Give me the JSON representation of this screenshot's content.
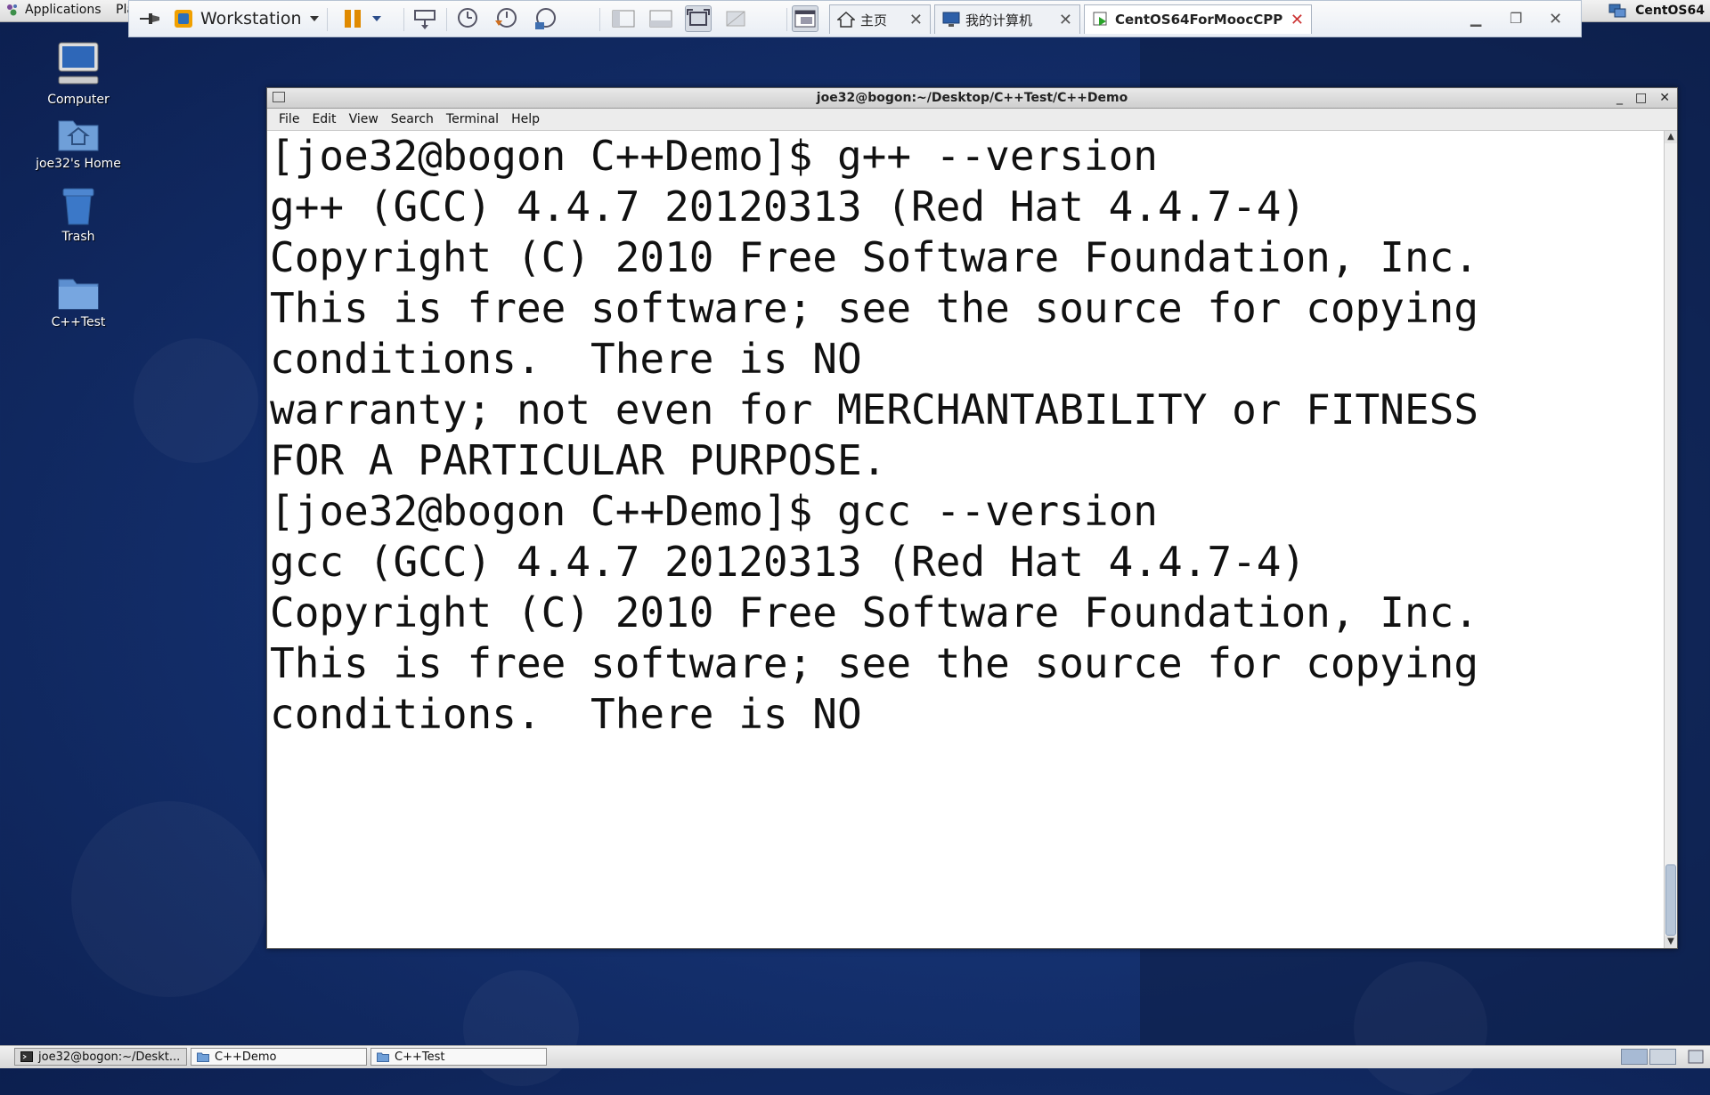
{
  "gnome_panel": {
    "applications_label": "Applications",
    "places_label": "Pla",
    "host_label": "CentOS64"
  },
  "vmware": {
    "workstation_label": "Workstation",
    "tabs": [
      {
        "label": "主页"
      },
      {
        "label": "我的计算机"
      },
      {
        "label": "CentOS64ForMoocCPP"
      }
    ]
  },
  "desktop_icons": [
    {
      "label": "Computer"
    },
    {
      "label": "joe32's Home"
    },
    {
      "label": "Trash"
    },
    {
      "label": "C++Test"
    }
  ],
  "terminal": {
    "title": "joe32@bogon:~/Desktop/C++Test/C++Demo",
    "menu": [
      "File",
      "Edit",
      "View",
      "Search",
      "Terminal",
      "Help"
    ],
    "lines": [
      "",
      "",
      "",
      "[joe32@bogon C++Demo]$ g++ --version",
      "g++ (GCC) 4.4.7 20120313 (Red Hat 4.4.7-4)",
      "Copyright (C) 2010 Free Software Foundation, Inc.",
      "This is free software; see the source for copying",
      "conditions.  There is NO",
      "warranty; not even for MERCHANTABILITY or FITNESS",
      "FOR A PARTICULAR PURPOSE.",
      "",
      "[joe32@bogon C++Demo]$ gcc --version",
      "gcc (GCC) 4.4.7 20120313 (Red Hat 4.4.7-4)",
      "Copyright (C) 2010 Free Software Foundation, Inc.",
      "This is free software; see the source for copying",
      "conditions.  There is NO"
    ]
  },
  "taskbar": {
    "tasks": [
      {
        "label": "joe32@bogon:~/Deskt..."
      },
      {
        "label": "C++Demo"
      },
      {
        "label": "C++Test"
      }
    ]
  }
}
